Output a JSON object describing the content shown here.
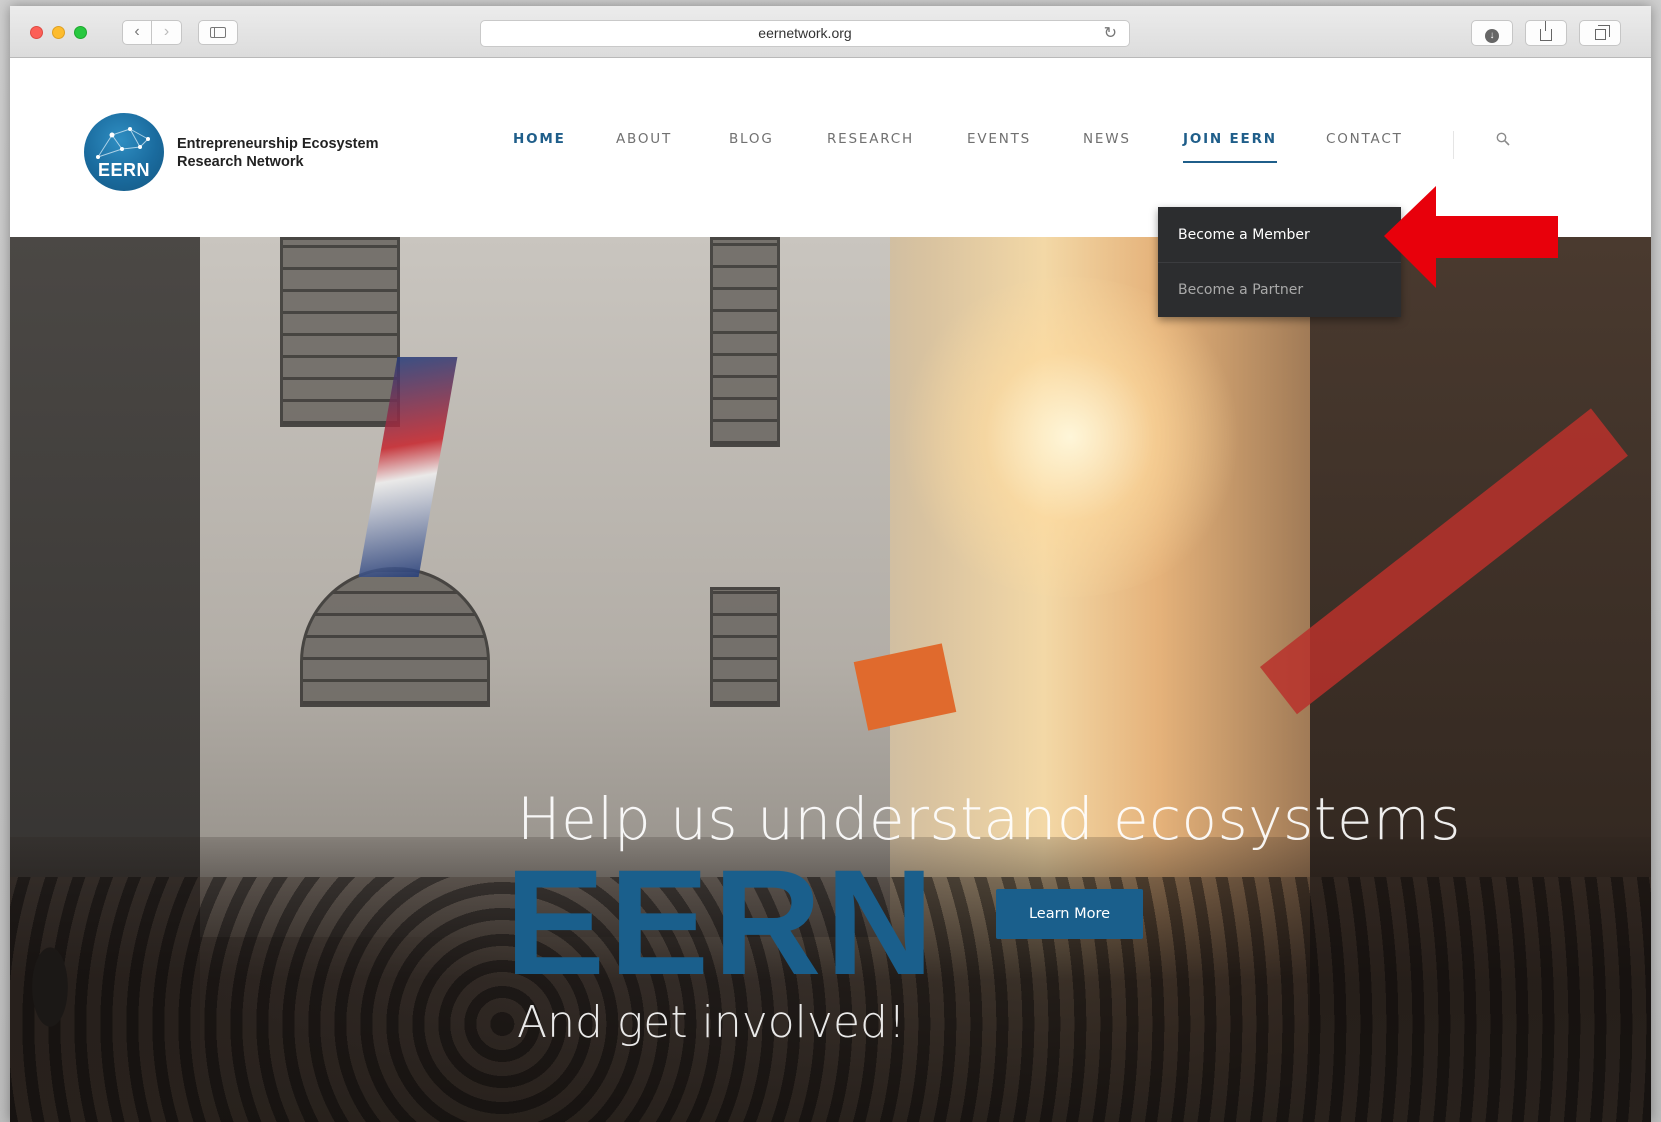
{
  "browser": {
    "url": "eernetwork.org"
  },
  "site": {
    "logo_text": "EERN",
    "org_name_line1": "Entrepreneurship Ecosystem",
    "org_name_line2": "Research Network"
  },
  "nav": {
    "items": [
      {
        "label": "HOME",
        "state": "active"
      },
      {
        "label": "ABOUT",
        "state": "normal"
      },
      {
        "label": "BLOG",
        "state": "normal"
      },
      {
        "label": "RESEARCH",
        "state": "normal"
      },
      {
        "label": "EVENTS",
        "state": "normal"
      },
      {
        "label": "NEWS",
        "state": "normal"
      },
      {
        "label": "JOIN EERN",
        "state": "hover"
      },
      {
        "label": "CONTACT",
        "state": "normal"
      }
    ],
    "search_icon": "search-icon"
  },
  "dropdown": {
    "items": [
      {
        "label": "Become a Member"
      },
      {
        "label": "Become a Partner"
      }
    ]
  },
  "hero": {
    "title": "Help us understand ecosystems",
    "brand": "EERN",
    "subtitle": "And get involved!",
    "cta_label": "Learn More"
  },
  "colors": {
    "brand_blue": "#1a5f8c",
    "nav_active": "#1f5e8a",
    "dropdown_bg": "#2c2d2f",
    "annotation_arrow": "#e8000b"
  }
}
